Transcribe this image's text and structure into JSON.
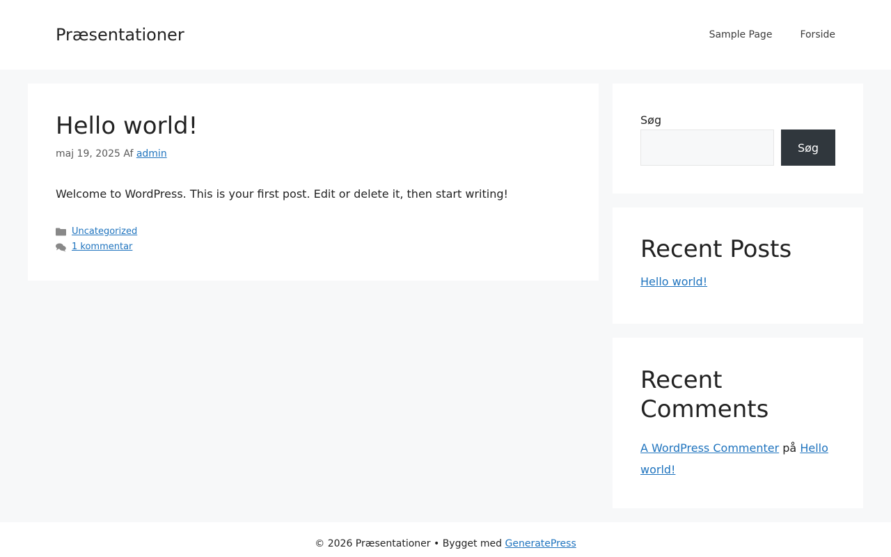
{
  "header": {
    "site_title": "Præsentationer",
    "nav": [
      {
        "label": "Sample Page"
      },
      {
        "label": "Forside"
      }
    ]
  },
  "post": {
    "title": "Hello world!",
    "date": "maj 19, 2025",
    "by": "Af",
    "author": "admin",
    "content": "Welcome to WordPress. This is your first post. Edit or delete it, then start writing!",
    "category": "Uncategorized",
    "comments": "1 kommentar"
  },
  "search": {
    "label": "Søg",
    "button_label": "Søg",
    "value": "",
    "placeholder": ""
  },
  "recent_posts": {
    "title": "Recent Posts",
    "items": [
      {
        "label": "Hello world!"
      }
    ]
  },
  "recent_comments": {
    "title": "Recent Comments",
    "author": "A WordPress Commenter",
    "on": "på",
    "post": "Hello world!"
  },
  "footer": {
    "text": "© 2026 Præsentationer • Bygget med",
    "link": "GeneratePress"
  },
  "colors": {
    "link": "#1e73be",
    "button_bg": "#30373d",
    "page_bg": "#f7f8f9"
  },
  "icons": {
    "category": "folder-icon",
    "comments": "comments-icon"
  }
}
